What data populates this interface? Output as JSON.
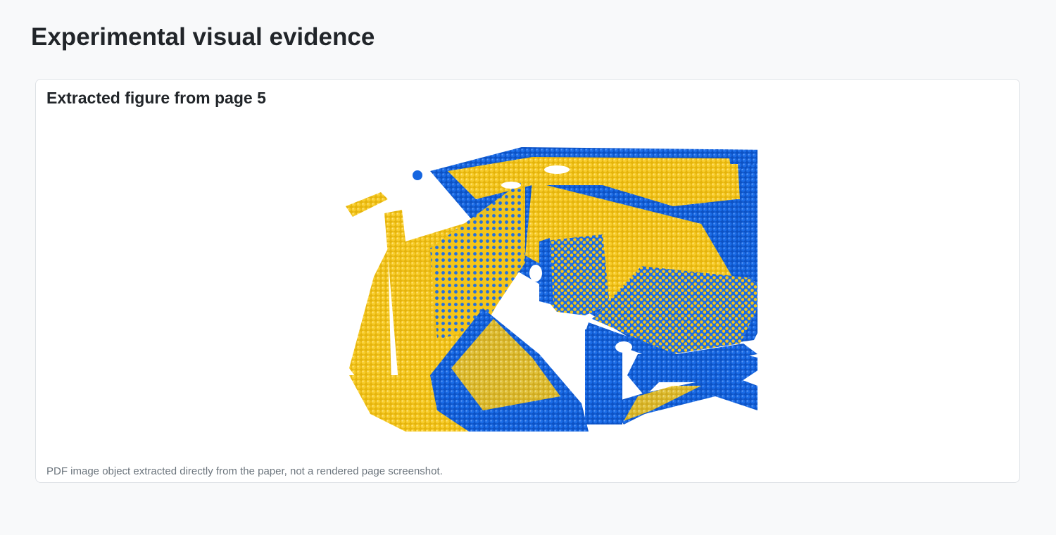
{
  "page": {
    "title": "Experimental visual evidence"
  },
  "figure_card": {
    "title": "Extracted figure from page 5",
    "caption": "PDF image object extracted directly from the paper, not a rendered page screenshot.",
    "image": {
      "kind": "3D point cloud render",
      "colors": {
        "yellow": "#f5c518",
        "yellow_dark": "#c99a00",
        "blue": "#1565e0",
        "blue_dark": "#0b3f99"
      }
    }
  }
}
